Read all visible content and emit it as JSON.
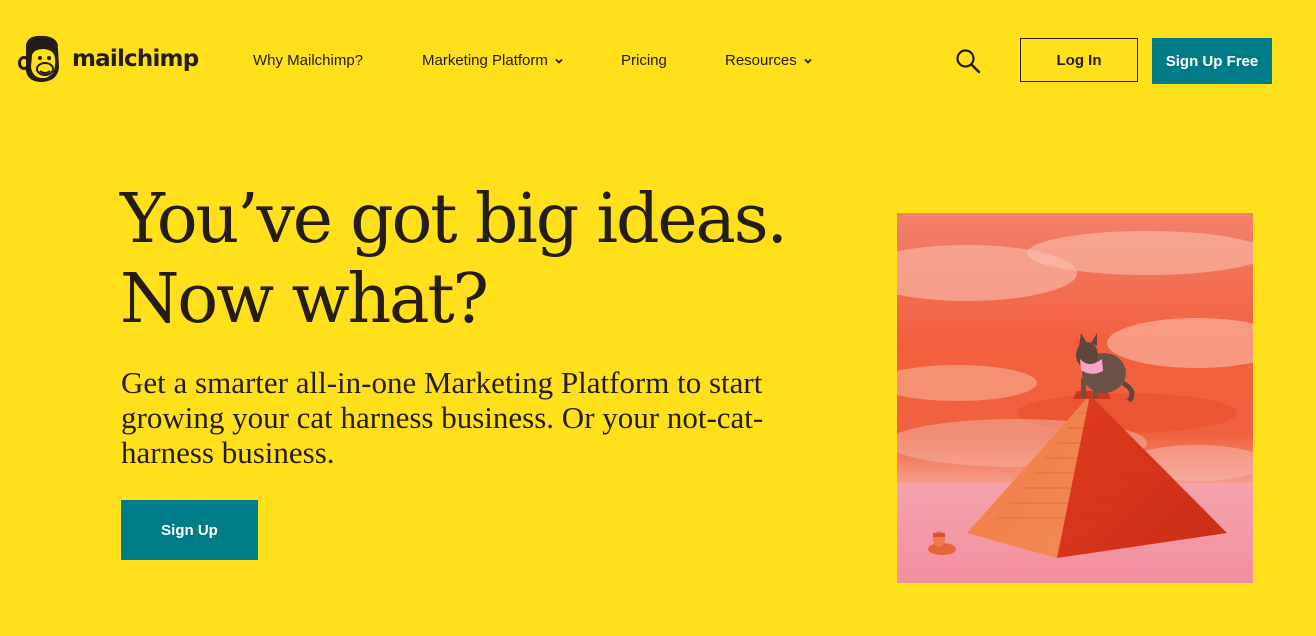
{
  "brand": {
    "name": "mailchimp",
    "background_color": "#FFE01B",
    "accent_color": "#007c89",
    "text_color": "#241c15"
  },
  "nav": {
    "items": [
      {
        "label": "Why Mailchimp?",
        "has_dropdown": false
      },
      {
        "label": "Marketing Platform",
        "has_dropdown": true
      },
      {
        "label": "Pricing",
        "has_dropdown": false
      },
      {
        "label": "Resources",
        "has_dropdown": true
      }
    ],
    "search_icon": "search-icon",
    "login_label": "Log In",
    "signup_free_label": "Sign Up Free"
  },
  "hero": {
    "title": "You’ve got big ideas. Now what?",
    "subtitle": "Get a smarter all-in-one Marketing Platform to start growing your cat harness business. Or your not-cat-harness business.",
    "cta_label": "Sign Up",
    "image": "cat-on-pyramid-illustration"
  }
}
